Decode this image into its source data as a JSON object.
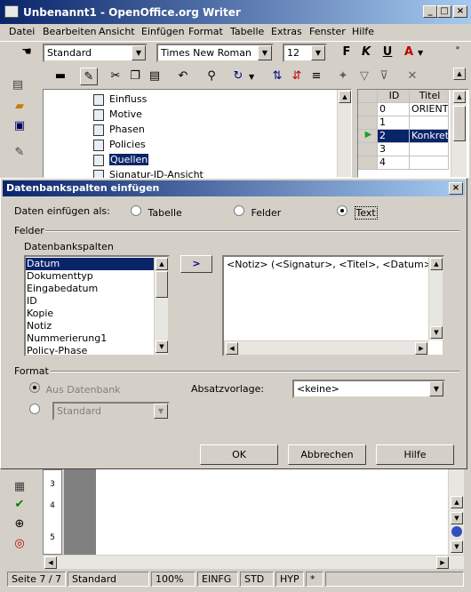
{
  "window": {
    "title": "Unbenannt1 - OpenOffice.org Writer"
  },
  "menu": [
    "Datei",
    "Bearbeiten",
    "Ansicht",
    "Einfügen",
    "Format",
    "Tabelle",
    "Extras",
    "Fenster",
    "Hilfe"
  ],
  "format_toolbar": {
    "style": "Standard",
    "font": "Times New Roman",
    "size": "12"
  },
  "tree": {
    "items": [
      "Einfluss",
      "Motive",
      "Phasen",
      "Policies",
      "Quellen",
      "Signatur-ID-Ansicht"
    ],
    "selected": "Quellen"
  },
  "table_grid": {
    "headers": [
      "ID",
      "Titel"
    ],
    "rows": [
      {
        "id": "0",
        "title": "ORIENT"
      },
      {
        "id": "1",
        "title": ""
      },
      {
        "id": "2",
        "title": "Konkreti"
      },
      {
        "id": "3",
        "title": ""
      },
      {
        "id": "4",
        "title": ""
      }
    ]
  },
  "dialog": {
    "title": "Datenbankspalten einfügen",
    "insert_as_label": "Daten einfügen als:",
    "insert_options": [
      "Tabelle",
      "Felder",
      "Text"
    ],
    "selected_option": "Text",
    "fields_group": "Felder",
    "db_columns_label": "Datenbankspalten",
    "columns": [
      "Datum",
      "Dokumenttyp",
      "Eingabedatum",
      "ID",
      "Kopie",
      "Notiz",
      "Nummerierung1",
      "Policy-Phase"
    ],
    "selected_column": "Datum",
    "move_button": ">",
    "text_content": "<Notiz> (<Signatur>,  <Titel>,  <Datum>)",
    "format_group": "Format",
    "from_db_label": "Aus Datenbank",
    "format_value": "Standard",
    "paragraph_style_label": "Absatzvorlage:",
    "paragraph_style_value": "<keine>",
    "ok": "OK",
    "cancel": "Abbrechen",
    "help": "Hilfe"
  },
  "ruler_numbers": [
    "3",
    "4",
    "5"
  ],
  "status": {
    "page": "Seite 7 / 7",
    "style": "Standard",
    "zoom": "100%",
    "insert": "EINFG",
    "sel": "STD",
    "hyp": "HYP",
    "modified": "*"
  }
}
